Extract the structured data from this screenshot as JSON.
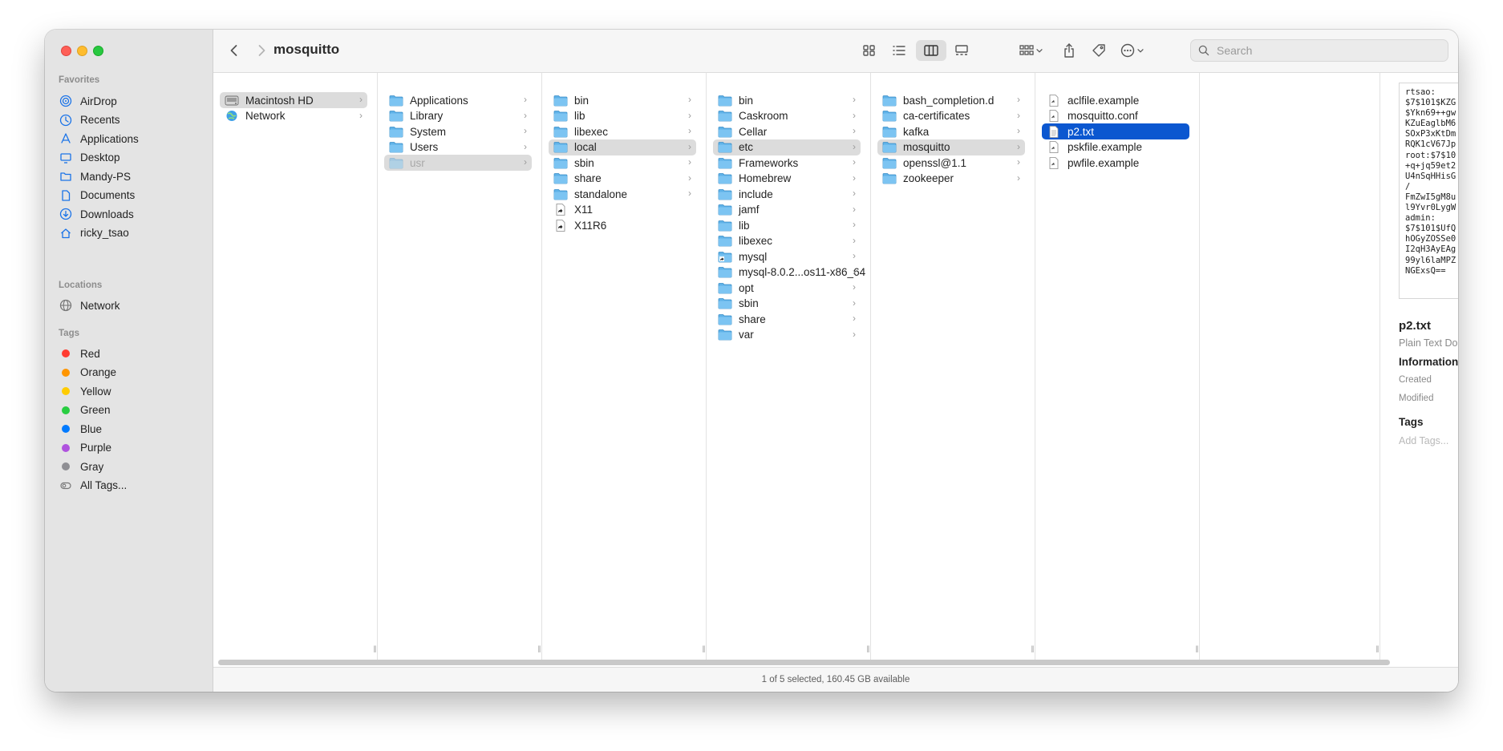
{
  "window": {
    "title": "mosquitto"
  },
  "search": {
    "placeholder": "Search"
  },
  "sidebar": {
    "favorites_label": "Favorites",
    "favorites": [
      {
        "label": "AirDrop",
        "icon": "airdrop-icon"
      },
      {
        "label": "Recents",
        "icon": "clock-icon"
      },
      {
        "label": "Applications",
        "icon": "applications-icon"
      },
      {
        "label": "Desktop",
        "icon": "desktop-icon"
      },
      {
        "label": "Mandy-PS",
        "icon": "folder-icon"
      },
      {
        "label": "Documents",
        "icon": "document-icon"
      },
      {
        "label": "Downloads",
        "icon": "download-icon"
      },
      {
        "label": "ricky_tsao",
        "icon": "home-icon"
      }
    ],
    "locations_label": "Locations",
    "locations": [
      {
        "label": "Network",
        "icon": "network-icon"
      }
    ],
    "tags_label": "Tags",
    "tags": [
      {
        "label": "Red",
        "color": "#ff3b30"
      },
      {
        "label": "Orange",
        "color": "#ff9500"
      },
      {
        "label": "Yellow",
        "color": "#ffcc00"
      },
      {
        "label": "Green",
        "color": "#28cd41"
      },
      {
        "label": "Blue",
        "color": "#007aff"
      },
      {
        "label": "Purple",
        "color": "#af52de"
      },
      {
        "label": "Gray",
        "color": "#8e8e93"
      },
      {
        "label": "All Tags...",
        "color": ""
      }
    ]
  },
  "columns": [
    {
      "items": [
        {
          "label": "Macintosh HD",
          "state": "selected",
          "icon": "hard-drive-icon"
        },
        {
          "label": "Network",
          "state": "normal",
          "icon": "network-icon"
        }
      ]
    },
    {
      "items": [
        {
          "label": "Applications",
          "state": "normal"
        },
        {
          "label": "Library",
          "state": "normal"
        },
        {
          "label": "System",
          "state": "normal"
        },
        {
          "label": "Users",
          "state": "normal"
        },
        {
          "label": "usr",
          "state": "selected-dim"
        }
      ]
    },
    {
      "items": [
        {
          "label": "bin",
          "state": "normal"
        },
        {
          "label": "lib",
          "state": "normal"
        },
        {
          "label": "libexec",
          "state": "normal"
        },
        {
          "label": "local",
          "state": "selected"
        },
        {
          "label": "sbin",
          "state": "normal"
        },
        {
          "label": "share",
          "state": "normal"
        },
        {
          "label": "standalone",
          "state": "normal"
        },
        {
          "label": "X11",
          "state": "normal",
          "kind": "alias"
        },
        {
          "label": "X11R6",
          "state": "normal",
          "kind": "alias"
        }
      ]
    },
    {
      "items": [
        {
          "label": "bin",
          "state": "normal"
        },
        {
          "label": "Caskroom",
          "state": "normal"
        },
        {
          "label": "Cellar",
          "state": "normal"
        },
        {
          "label": "etc",
          "state": "selected"
        },
        {
          "label": "Frameworks",
          "state": "normal"
        },
        {
          "label": "Homebrew",
          "state": "normal"
        },
        {
          "label": "include",
          "state": "normal"
        },
        {
          "label": "jamf",
          "state": "normal"
        },
        {
          "label": "lib",
          "state": "normal"
        },
        {
          "label": "libexec",
          "state": "normal"
        },
        {
          "label": "mysql",
          "state": "normal",
          "kind": "alias-folder"
        },
        {
          "label": "mysql-8.0.2...os11-x86_64",
          "state": "normal"
        },
        {
          "label": "opt",
          "state": "normal"
        },
        {
          "label": "sbin",
          "state": "normal"
        },
        {
          "label": "share",
          "state": "normal"
        },
        {
          "label": "var",
          "state": "normal"
        }
      ]
    },
    {
      "items": [
        {
          "label": "bash_completion.d",
          "state": "normal"
        },
        {
          "label": "ca-certificates",
          "state": "normal"
        },
        {
          "label": "kafka",
          "state": "normal"
        },
        {
          "label": "mosquitto",
          "state": "selected"
        },
        {
          "label": "openssl@1.1",
          "state": "normal"
        },
        {
          "label": "zookeeper",
          "state": "normal"
        }
      ]
    },
    {
      "items": [
        {
          "label": "aclfile.example",
          "state": "normal",
          "kind": "exec"
        },
        {
          "label": "mosquitto.conf",
          "state": "normal",
          "kind": "exec"
        },
        {
          "label": "p2.txt",
          "state": "active",
          "kind": "text"
        },
        {
          "label": "pskfile.example",
          "state": "normal",
          "kind": "exec"
        },
        {
          "label": "pwfile.example",
          "state": "normal",
          "kind": "exec"
        }
      ]
    }
  ],
  "preview": {
    "content": "rtsao:\n$7$101$KZG\n$Ykn69++gw\nKZuEaglbM6\nSOxP3xKtDm\nRQK1cV67Jp\nroot:$7$10\n+q+jq59et2\nU4nSqHHisG\n/\nFmZwI5gM8u\nl9Yvr0LygW\nadmin:\n$7$101$UfQ\nhOGyZOSSe0\nI2qH3AyEAg\n99yl6laMPZ\nNGExsQ==",
    "name": "p2.txt",
    "kind": "Plain Text Do",
    "info_label": "Information",
    "created_label": "Created",
    "modified_label": "Modified",
    "tags_label": "Tags",
    "add_tags": "Add Tags..."
  },
  "status": {
    "text": "1 of 5 selected, 160.45 GB available"
  }
}
